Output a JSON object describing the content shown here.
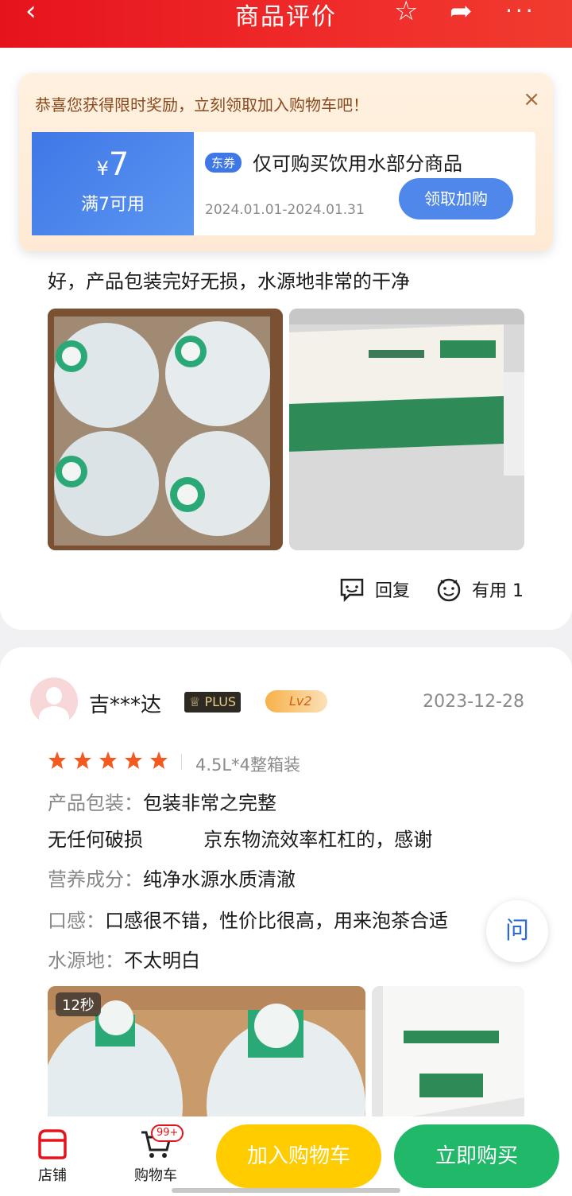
{
  "header": {
    "title": "商品评价",
    "back_icon": "back-arrow-icon",
    "star_icon": "star-icon",
    "share_icon": "share-icon",
    "more_icon": "more-icon",
    "bg_color": "#e5141c"
  },
  "coupon_popup": {
    "tip": "恭喜您获得限时奖励，立刻领取加入购物车吧！",
    "close_icon": "×",
    "coupon": {
      "currency": "¥",
      "amount": "7",
      "condition": "满7可用",
      "tag": "东券",
      "description": "仅可购买饮用水部分商品",
      "validity": "2024.01.01-2024.01.31",
      "claim_label": "领取加购"
    }
  },
  "review1": {
    "text": "好，产品包装完好无损，水源地非常的干净",
    "reply_label": "回复",
    "useful_label": "有用 1"
  },
  "review2": {
    "username": "吉***达",
    "plus_badge": "PLUS",
    "level_badge": "Lv2",
    "date": "2023-12-28",
    "rating": 5,
    "spec": "4.5L*4整箱装",
    "lines": {
      "packaging_key": "产品包装：",
      "packaging_val": "包装非常之完整",
      "extra": "无任何破损          京东物流效率杠杠的，感谢",
      "nutrition_key": "营养成分：",
      "nutrition_val": "纯净水源水质清澈",
      "taste_key": "口感：",
      "taste_val": "口感很不错，性价比很高，用来泡茶合适",
      "source_key": "水源地：",
      "source_val": "不太明白"
    },
    "video_duration": "12秒"
  },
  "ask_float": "问",
  "bottom_bar": {
    "shop_label": "店铺",
    "cart_label": "购物车",
    "cart_badge": "99+",
    "add_cart_label": "加入购物车",
    "buy_label": "立即购买"
  },
  "colors": {
    "accent_red": "#e5141c",
    "cart_yellow": "#ffcc00",
    "buy_green": "#22b86a",
    "coupon_blue": "#3f78e6",
    "star_orange": "#f25a22"
  }
}
